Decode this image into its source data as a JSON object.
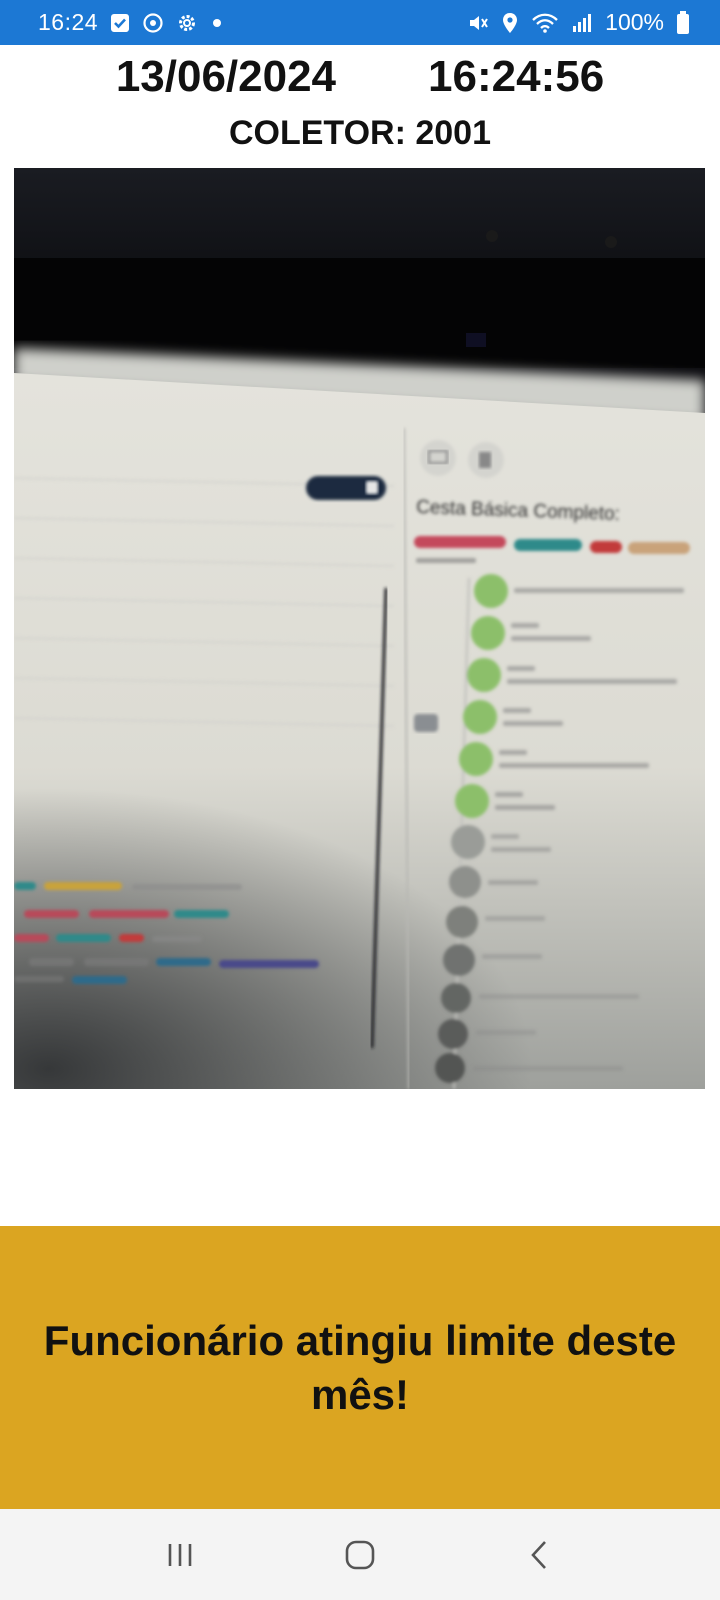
{
  "status_bar": {
    "time": "16:24",
    "battery_percent": "100%",
    "background_color": "#1c78d4",
    "icons_left": [
      "checkbox-icon",
      "sync-icon",
      "gear-icon",
      "dot-icon"
    ],
    "icons_right": [
      "mute-icon",
      "location-icon",
      "wifi-icon",
      "signal-icon",
      "battery-icon"
    ]
  },
  "header": {
    "date": "13/06/2024",
    "time": "16:24:56",
    "collector_label": "COLETOR: 2001"
  },
  "camera_preview": {
    "visible_text": "Cesta Básica Completo:"
  },
  "alert": {
    "message": "Funcionário atingiu limite deste mês!",
    "background_color": "#dba521"
  },
  "nav_bar": {
    "buttons": [
      "recent-apps-icon",
      "home-icon",
      "back-icon"
    ]
  }
}
